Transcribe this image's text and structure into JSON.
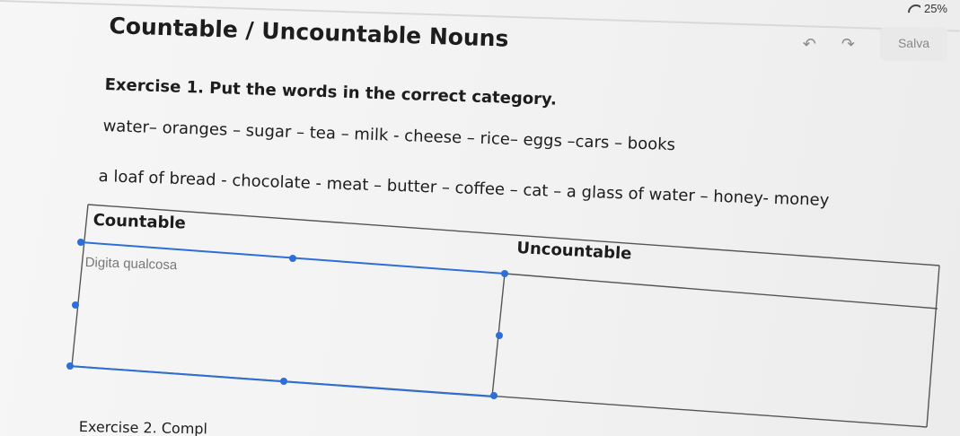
{
  "status": {
    "battery": "25%"
  },
  "toolbar": {
    "save_label": "Salva"
  },
  "document": {
    "title": "Countable / Uncountable Nouns",
    "exercise1": "Exercise 1. Put the words in the correct category.",
    "words_line1": "water– oranges – sugar – tea – milk - cheese – rice– eggs –cars – books",
    "words_line2": "a loaf of bread -  chocolate - meat – butter – coffee – cat – a glass of water – honey- money",
    "exercise2_partial": "Exercise 2. Compl"
  },
  "table": {
    "headers": [
      "Countable",
      "Uncountable"
    ],
    "input_placeholder": "Digita qualcosa"
  },
  "colors": {
    "selection_handle": "#2d6fd6",
    "border": "#555555"
  }
}
